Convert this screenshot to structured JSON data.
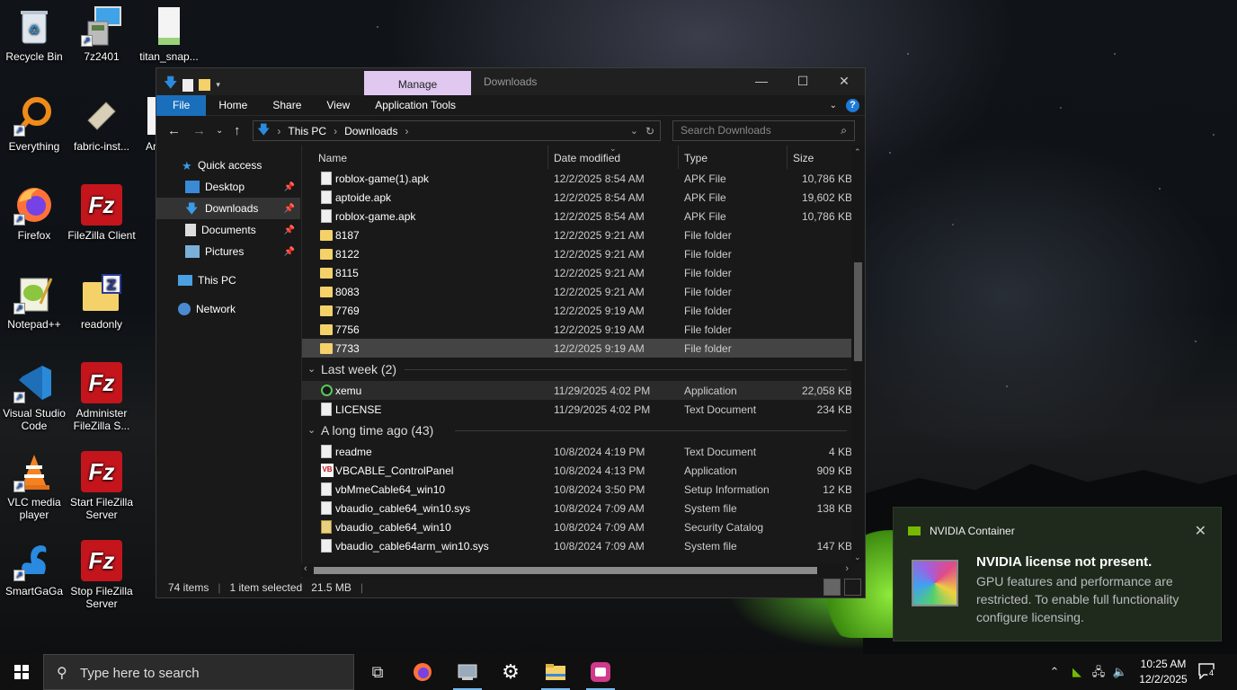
{
  "desktop": {
    "icons": [
      {
        "label": "Recycle Bin"
      },
      {
        "label": "7z2401"
      },
      {
        "label": "titan_snap..."
      },
      {
        "label": "Everything"
      },
      {
        "label": "fabric-inst..."
      },
      {
        "label": "Ar"
      },
      {
        "label": "Firefox"
      },
      {
        "label": "FileZilla Client"
      },
      {
        "label": "Notepad++"
      },
      {
        "label": "readonly"
      },
      {
        "label": "Visual Studio Code"
      },
      {
        "label": "Administer FileZilla S..."
      },
      {
        "label": "VLC media player"
      },
      {
        "label": "Start FileZilla Server"
      },
      {
        "label": "SmartGaGa"
      },
      {
        "label": "Stop FileZilla Server"
      }
    ]
  },
  "explorer": {
    "manage_tab": "Manage",
    "title": "Downloads",
    "ribbon_tabs": [
      "File",
      "Home",
      "Share",
      "View",
      "Application Tools"
    ],
    "address": {
      "crumbs": [
        "This PC",
        "Downloads"
      ]
    },
    "search_placeholder": "Search Downloads",
    "nav": {
      "quick_access": "Quick access",
      "items": [
        "Desktop",
        "Downloads",
        "Documents",
        "Pictures"
      ],
      "this_pc": "This PC",
      "network": "Network"
    },
    "columns": {
      "name": "Name",
      "date": "Date modified",
      "type": "Type",
      "size": "Size"
    },
    "rows_top": [
      {
        "name": "roblox-game(1).apk",
        "date": "12/2/2025 8:54 AM",
        "type": "APK File",
        "size": "10,786 KB",
        "icon": "doc"
      },
      {
        "name": "aptoide.apk",
        "date": "12/2/2025 8:54 AM",
        "type": "APK File",
        "size": "19,602 KB",
        "icon": "doc"
      },
      {
        "name": "roblox-game.apk",
        "date": "12/2/2025 8:54 AM",
        "type": "APK File",
        "size": "10,786 KB",
        "icon": "doc"
      },
      {
        "name": "8187",
        "date": "12/2/2025 9:21 AM",
        "type": "File folder",
        "size": "",
        "icon": "folder"
      },
      {
        "name": "8122",
        "date": "12/2/2025 9:21 AM",
        "type": "File folder",
        "size": "",
        "icon": "folder"
      },
      {
        "name": "8115",
        "date": "12/2/2025 9:21 AM",
        "type": "File folder",
        "size": "",
        "icon": "folder"
      },
      {
        "name": "8083",
        "date": "12/2/2025 9:21 AM",
        "type": "File folder",
        "size": "",
        "icon": "folder"
      },
      {
        "name": "7769",
        "date": "12/2/2025 9:19 AM",
        "type": "File folder",
        "size": "",
        "icon": "folder"
      },
      {
        "name": "7756",
        "date": "12/2/2025 9:19 AM",
        "type": "File folder",
        "size": "",
        "icon": "folder"
      },
      {
        "name": "7733",
        "date": "12/2/2025 9:19 AM",
        "type": "File folder",
        "size": "",
        "icon": "folder"
      }
    ],
    "group_lastweek": "Last week (2)",
    "rows_lastweek": [
      {
        "name": "xemu",
        "date": "11/29/2025 4:02 PM",
        "type": "Application",
        "size": "22,058 KB",
        "icon": "app"
      },
      {
        "name": "LICENSE",
        "date": "11/29/2025 4:02 PM",
        "type": "Text Document",
        "size": "234 KB",
        "icon": "doc"
      }
    ],
    "group_longago": "A long time ago (43)",
    "rows_longago": [
      {
        "name": "readme",
        "date": "10/8/2024 4:19 PM",
        "type": "Text Document",
        "size": "4 KB",
        "icon": "doc"
      },
      {
        "name": "VBCABLE_ControlPanel",
        "date": "10/8/2024 4:13 PM",
        "type": "Application",
        "size": "909 KB",
        "icon": "vb"
      },
      {
        "name": "vbMmeCable64_win10",
        "date": "10/8/2024 3:50 PM",
        "type": "Setup Information",
        "size": "12 KB",
        "icon": "doc"
      },
      {
        "name": "vbaudio_cable64_win10.sys",
        "date": "10/8/2024 7:09 AM",
        "type": "System file",
        "size": "138 KB",
        "icon": "doc"
      },
      {
        "name": "vbaudio_cable64_win10",
        "date": "10/8/2024 7:09 AM",
        "type": "Security Catalog",
        "size": "",
        "icon": "cat"
      },
      {
        "name": "vbaudio_cable64arm_win10.sys",
        "date": "10/8/2024 7:09 AM",
        "type": "System file",
        "size": "147 KB",
        "icon": "doc"
      }
    ],
    "status": {
      "count": "74 items",
      "selected": "1 item selected",
      "size": "21.5 MB"
    }
  },
  "notification": {
    "app": "NVIDIA Container",
    "title": "NVIDIA license not present.",
    "body": "GPU features and performance are restricted. To enable full functionality configure licensing."
  },
  "taskbar": {
    "search_placeholder": "Type here to search",
    "time": "10:25 AM",
    "date": "12/2/2025",
    "notif_count": "4"
  }
}
